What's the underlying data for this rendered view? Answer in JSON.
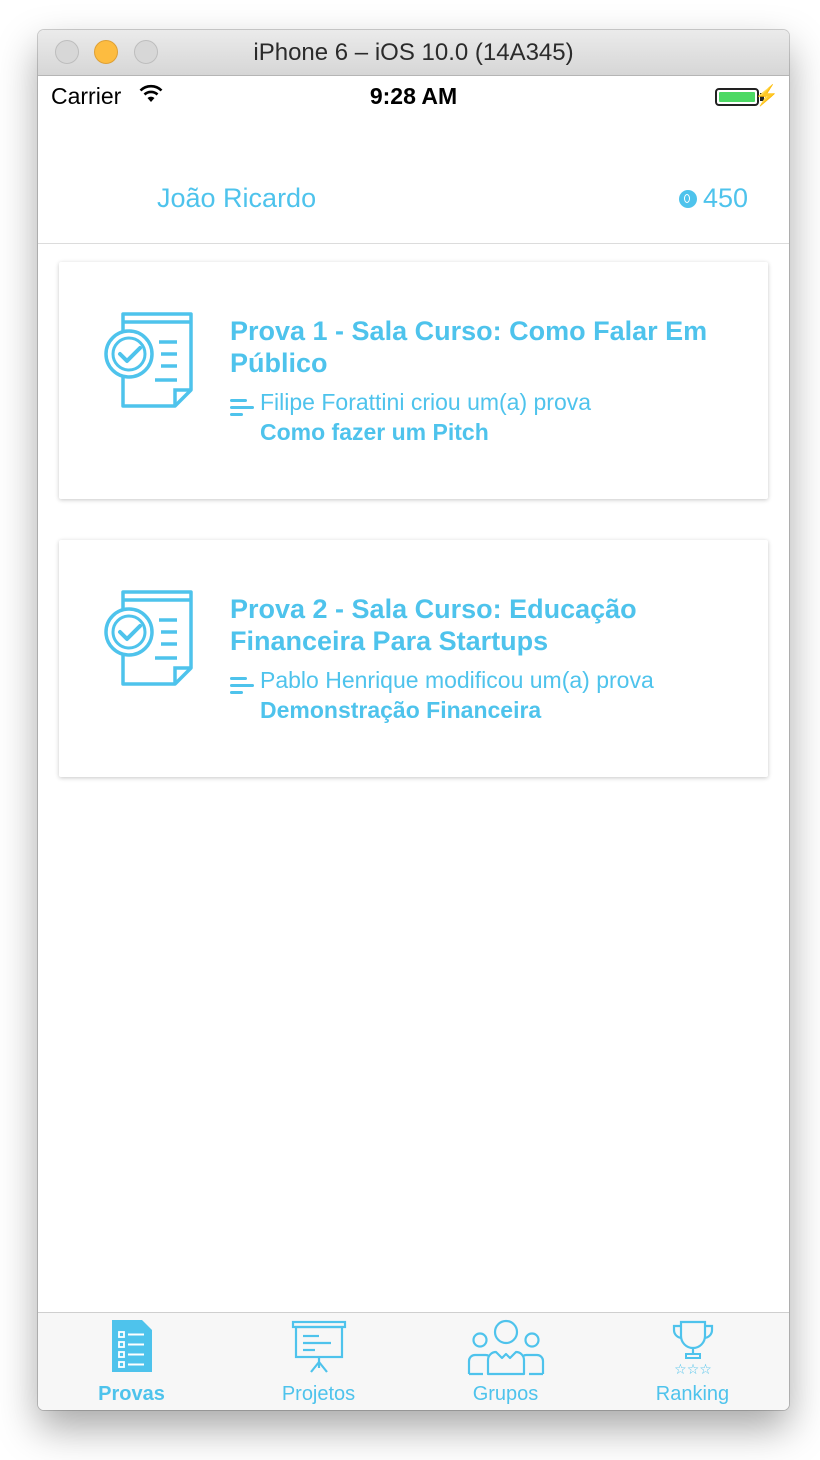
{
  "window": {
    "title": "iPhone 6 – iOS 10.0 (14A345)"
  },
  "status_bar": {
    "carrier": "Carrier",
    "time": "9:28 AM"
  },
  "header": {
    "user_name": "João Ricardo",
    "points": "450"
  },
  "colors": {
    "accent": "#4ec3ec",
    "battery": "#4cd964"
  },
  "cards": [
    {
      "title": "Prova 1 - Sala Curso: Como Falar Em Público",
      "actor": "Filipe Forattini criou um(a) prova",
      "subject": "Como fazer um Pitch",
      "icon": "exam-document-icon"
    },
    {
      "title": "Prova 2 - Sala Curso: Educação Financeira Para Startups",
      "actor": "Pablo Henrique modificou um(a) prova",
      "subject": "Demonstração Financeira",
      "icon": "exam-document-icon"
    }
  ],
  "tabbar": {
    "tabs": [
      {
        "label": "Provas",
        "icon": "checklist-icon",
        "active": true
      },
      {
        "label": "Projetos",
        "icon": "presentation-board-icon",
        "active": false
      },
      {
        "label": "Grupos",
        "icon": "group-people-icon",
        "active": false
      },
      {
        "label": "Ranking",
        "icon": "trophy-icon",
        "active": false
      }
    ]
  }
}
